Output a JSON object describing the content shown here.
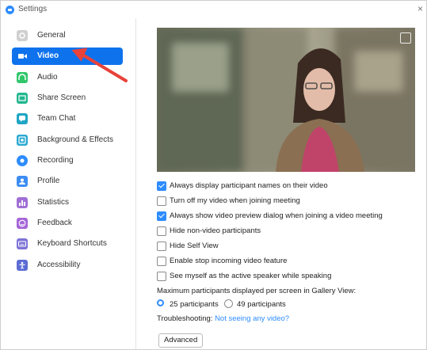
{
  "window": {
    "title": "Settings",
    "close_glyph": "×"
  },
  "sidebar": {
    "items": [
      {
        "label": "General",
        "icon": "gear-icon",
        "color": "#c9c9c9"
      },
      {
        "label": "Video",
        "icon": "video-camera-icon",
        "color": "#ffffff",
        "active": true
      },
      {
        "label": "Audio",
        "icon": "headphones-icon",
        "color": "#31c66b"
      },
      {
        "label": "Share Screen",
        "icon": "share-screen-icon",
        "color": "#23b68f"
      },
      {
        "label": "Team Chat",
        "icon": "chat-bubble-icon",
        "color": "#1fa6c4"
      },
      {
        "label": "Background & Effects",
        "icon": "background-effects-icon",
        "color": "#2aa9d1"
      },
      {
        "label": "Recording",
        "icon": "record-icon",
        "color": "#2d8cff"
      },
      {
        "label": "Profile",
        "icon": "profile-icon",
        "color": "#3d8df2"
      },
      {
        "label": "Statistics",
        "icon": "bar-chart-icon",
        "color": "#a06fd6"
      },
      {
        "label": "Feedback",
        "icon": "smiley-icon",
        "color": "#a565d8"
      },
      {
        "label": "Keyboard Shortcuts",
        "icon": "keyboard-icon",
        "color": "#7d74d6"
      },
      {
        "label": "Accessibility",
        "icon": "accessibility-icon",
        "color": "#5c6cd4"
      }
    ]
  },
  "video": {
    "options": [
      {
        "label": "Always display participant names on their video",
        "checked": true
      },
      {
        "label": "Turn off my video when joining meeting",
        "checked": false
      },
      {
        "label": "Always show video preview dialog when joining a video meeting",
        "checked": true
      },
      {
        "label": "Hide non-video participants",
        "checked": false
      },
      {
        "label": "Hide Self View",
        "checked": false
      },
      {
        "label": "Enable stop incoming video feature",
        "checked": false
      },
      {
        "label": "See myself as the active speaker while speaking",
        "checked": false
      }
    ],
    "gallery_label": "Maximum participants displayed per screen in Gallery View:",
    "gallery_options": [
      {
        "label": "25 participants",
        "selected": true
      },
      {
        "label": "49 participants",
        "selected": false
      }
    ],
    "troubleshooting_label": "Troubleshooting:",
    "troubleshooting_link": "Not seeing any video?",
    "advanced_label": "Advanced"
  },
  "colors": {
    "accent": "#0e72ed",
    "arrow": "#e8423a"
  }
}
